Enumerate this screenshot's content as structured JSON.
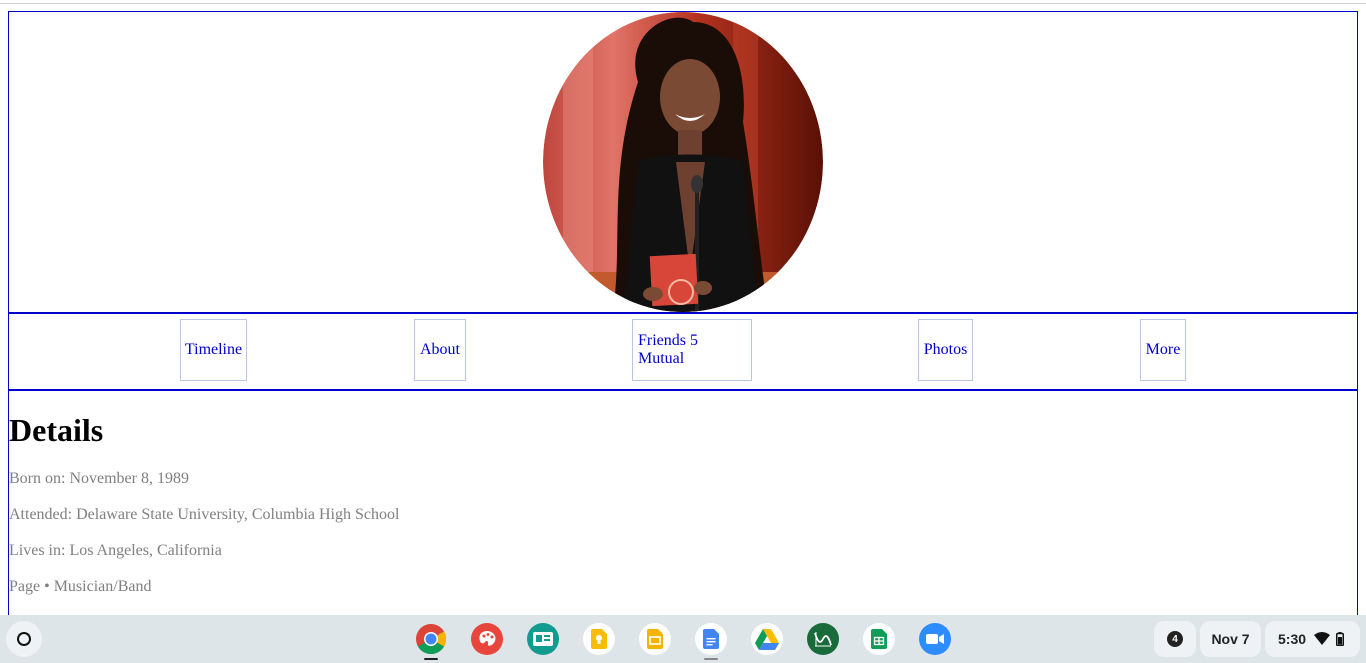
{
  "profile": {
    "avatar_alt": "Profile photo"
  },
  "nav": {
    "timeline": "Timeline",
    "about": "About",
    "friends": "Friends 5 Mutual",
    "photos": "Photos",
    "more": "More"
  },
  "details": {
    "heading": "Details",
    "born": "Born on: November 8, 1989",
    "attended": "Attended: Delaware State University, Columbia High School",
    "lives": "Lives in: Los Angeles, California",
    "page": "Page • Musician/Band"
  },
  "shelf": {
    "apps": [
      "chrome-icon",
      "palette-icon",
      "classroom-card-icon",
      "keep-icon",
      "slides-icon",
      "docs-icon",
      "drive-icon",
      "desmos-icon",
      "sheets-icon",
      "zoom-icon"
    ],
    "notification_count": "4",
    "date": "Nov 7",
    "time": "5:30"
  },
  "colors": {
    "link": "#0000cc",
    "border": "#0000cc",
    "muted_text": "#808080"
  }
}
